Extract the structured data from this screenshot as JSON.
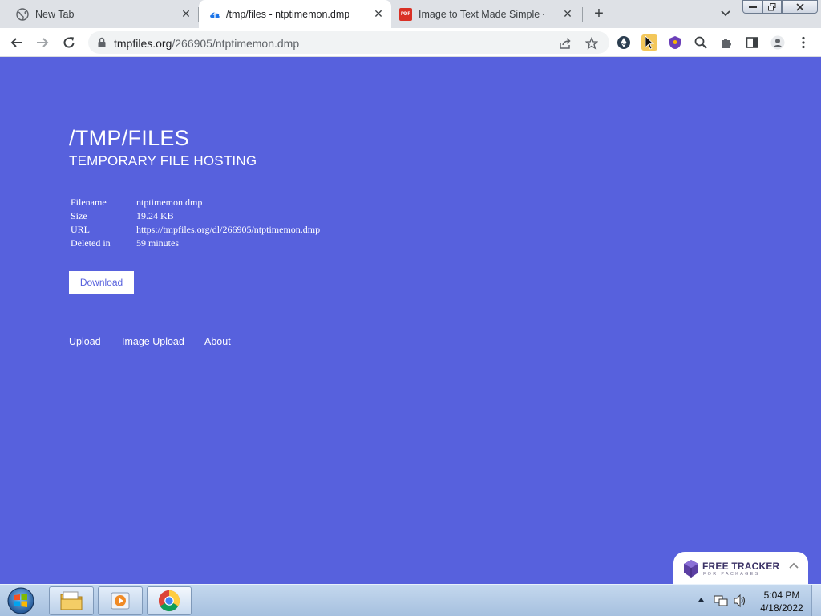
{
  "tabs": [
    {
      "title": "New Tab",
      "favicon": "globe-icon"
    },
    {
      "title": "/tmp/files - ntptimemon.dmp",
      "favicon": "cloud-upload-icon",
      "active": true
    },
    {
      "title": "Image to Text Made Simple - PDF",
      "favicon": "pdf-icon"
    }
  ],
  "favicon_pdf_text": "PDF",
  "new_tab_glyph": "+",
  "close_glyph": "✕",
  "address_bar": {
    "host": "tmpfiles.org",
    "path": "/266905/ntptimemon.dmp"
  },
  "page": {
    "title": "/TMP/FILES",
    "subtitle": "TEMPORARY FILE HOSTING",
    "info": [
      {
        "key": "Filename",
        "value": "ntptimemon.dmp"
      },
      {
        "key": "Size",
        "value": "19.24 KB"
      },
      {
        "key": "URL",
        "value": "https://tmpfiles.org/dl/266905/ntptimemon.dmp"
      },
      {
        "key": "Deleted in",
        "value": "59 minutes"
      }
    ],
    "download_label": "Download",
    "nav": [
      "Upload",
      "Image Upload",
      "About"
    ]
  },
  "tracker_widget": {
    "main": "FREE TRACKER",
    "sub": "FOR PACKAGES"
  },
  "clock": {
    "time": "5:04 PM",
    "date": "4/18/2022"
  },
  "colors": {
    "page_bg": "#5761dd",
    "tab_strip": "#dee1e6",
    "toolbar": "#ffffff",
    "taskbar": "#b6cde8"
  }
}
